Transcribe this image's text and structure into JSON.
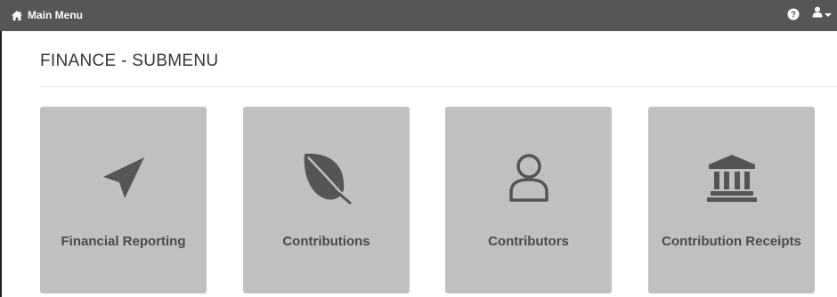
{
  "topbar": {
    "brand_label": "Main Menu",
    "home_icon": "home-icon",
    "help_icon": "question-circle-icon",
    "user_icon": "user-icon",
    "caret_icon": "caret-down-icon"
  },
  "page": {
    "title": "FINANCE - SUBMENU"
  },
  "tiles": [
    {
      "label": "Financial Reporting",
      "icon": "paper-plane-icon"
    },
    {
      "label": "Contributions",
      "icon": "leaf-icon"
    },
    {
      "label": "Contributors",
      "icon": "user-outline-icon"
    },
    {
      "label": "Contribution Receipts",
      "icon": "bank-icon"
    }
  ],
  "colors": {
    "topbar": "#565656",
    "tile_background": "#c0c0c0",
    "icon": "#555555",
    "label": "#4a4a4a"
  }
}
